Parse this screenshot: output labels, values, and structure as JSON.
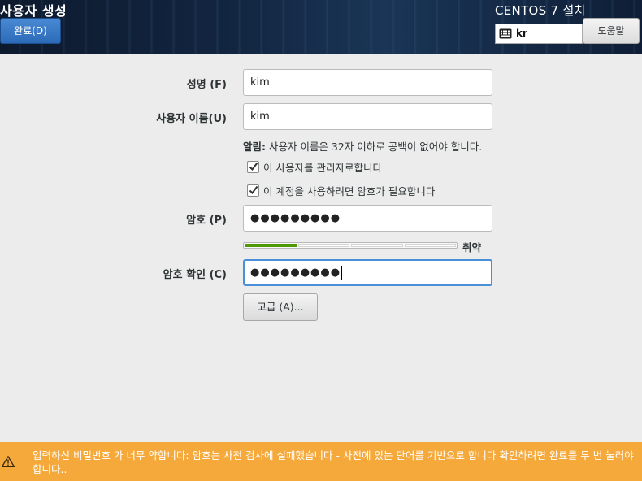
{
  "header": {
    "title": "사용자 생성",
    "done_label": "완료(D)",
    "install_title": "CENTOS 7 설치",
    "keyboard_layout": "kr",
    "help_label": "도움말"
  },
  "form": {
    "fullname_label": "성명 (F)",
    "fullname_value": "kim",
    "username_label": "사용자 이름(U)",
    "username_value": "kim",
    "hint_bold": "알림:",
    "hint_text": " 사용자 이름은 32자 이하로 공백이 없어야 합니다.",
    "admin_check_label": "이 사용자를 관리자로합니다",
    "admin_checked": true,
    "require_password_label": "이 계정을 사용하려면 암호가 필요합니다",
    "require_password_checked": true,
    "password_label": "암호 (P)",
    "password_value": "●●●●●●●●●",
    "strength_level": 0.25,
    "strength_text": "취약",
    "confirm_label": "암호 확인 (C)",
    "confirm_value": "●●●●●●●●●",
    "advanced_label": "고급 (A)..."
  },
  "warning": {
    "text": "입력하신 비밀번호 가 너무 약합니다: 암호는 사전 검사에 실패했습니다  - 사전에 있는 단어를 기반으로 합니다   확인하려면 완료를 두 번 눌러야 합니다.."
  },
  "colors": {
    "accent": "#4a90d9",
    "warning": "#f6a93b",
    "strength": "#4e9a06"
  }
}
